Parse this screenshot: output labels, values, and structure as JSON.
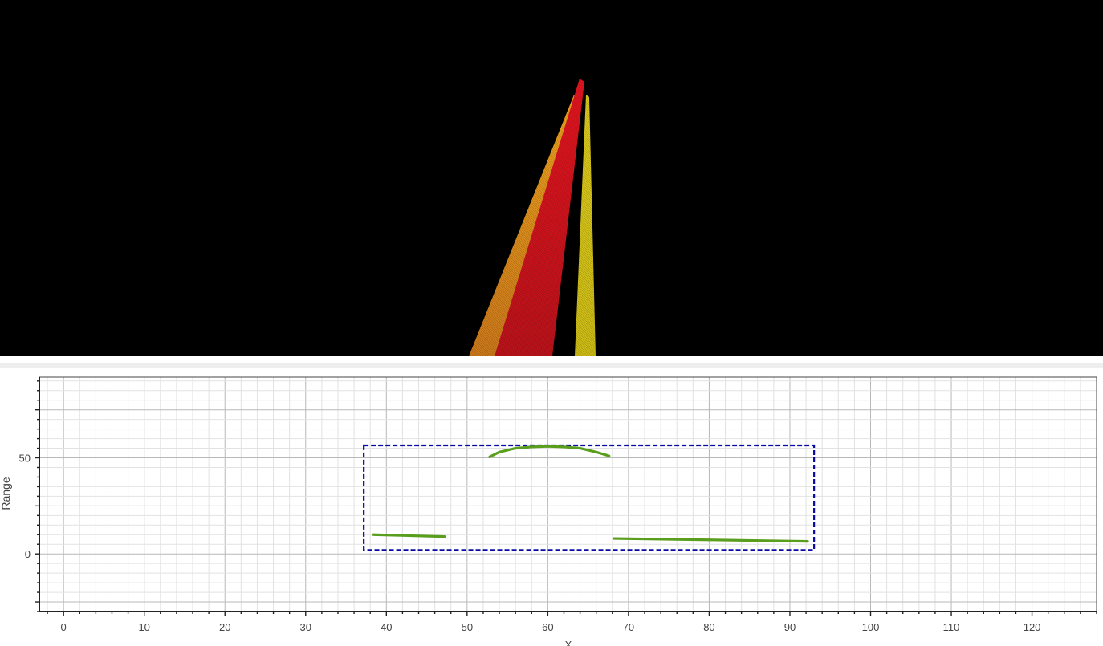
{
  "viewport": {
    "background": "#000000",
    "beam_colors": [
      "#e8b420",
      "#c0141a",
      "#d4c61c",
      "#c98a16"
    ]
  },
  "chart_data": {
    "type": "line",
    "title": "",
    "xlabel": "X",
    "ylabel": "Range",
    "xlim": [
      -3,
      128
    ],
    "ylim": [
      -30,
      92
    ],
    "x_ticks": [
      0,
      10,
      20,
      30,
      40,
      50,
      60,
      70,
      80,
      90,
      100,
      110,
      120
    ],
    "y_ticks": [
      0,
      50
    ],
    "grid": true,
    "series": [
      {
        "color": "#5a9e1e",
        "x": [
          38.4,
          47.2
        ],
        "y": [
          10,
          9
        ]
      },
      {
        "color": "#5a9e1e",
        "x": [
          52.8,
          54,
          56,
          58,
          60,
          62,
          64,
          66,
          67.6
        ],
        "y": [
          50.5,
          53,
          55,
          55.7,
          56,
          55.7,
          55,
          53,
          51
        ]
      },
      {
        "color": "#5a9e1e",
        "x": [
          68.2,
          80,
          92.2
        ],
        "y": [
          8,
          7.3,
          6.5
        ]
      }
    ],
    "region": {
      "color": "#0a0aa0",
      "x": [
        37.2,
        93
      ],
      "y": [
        2,
        56.5
      ]
    }
  }
}
